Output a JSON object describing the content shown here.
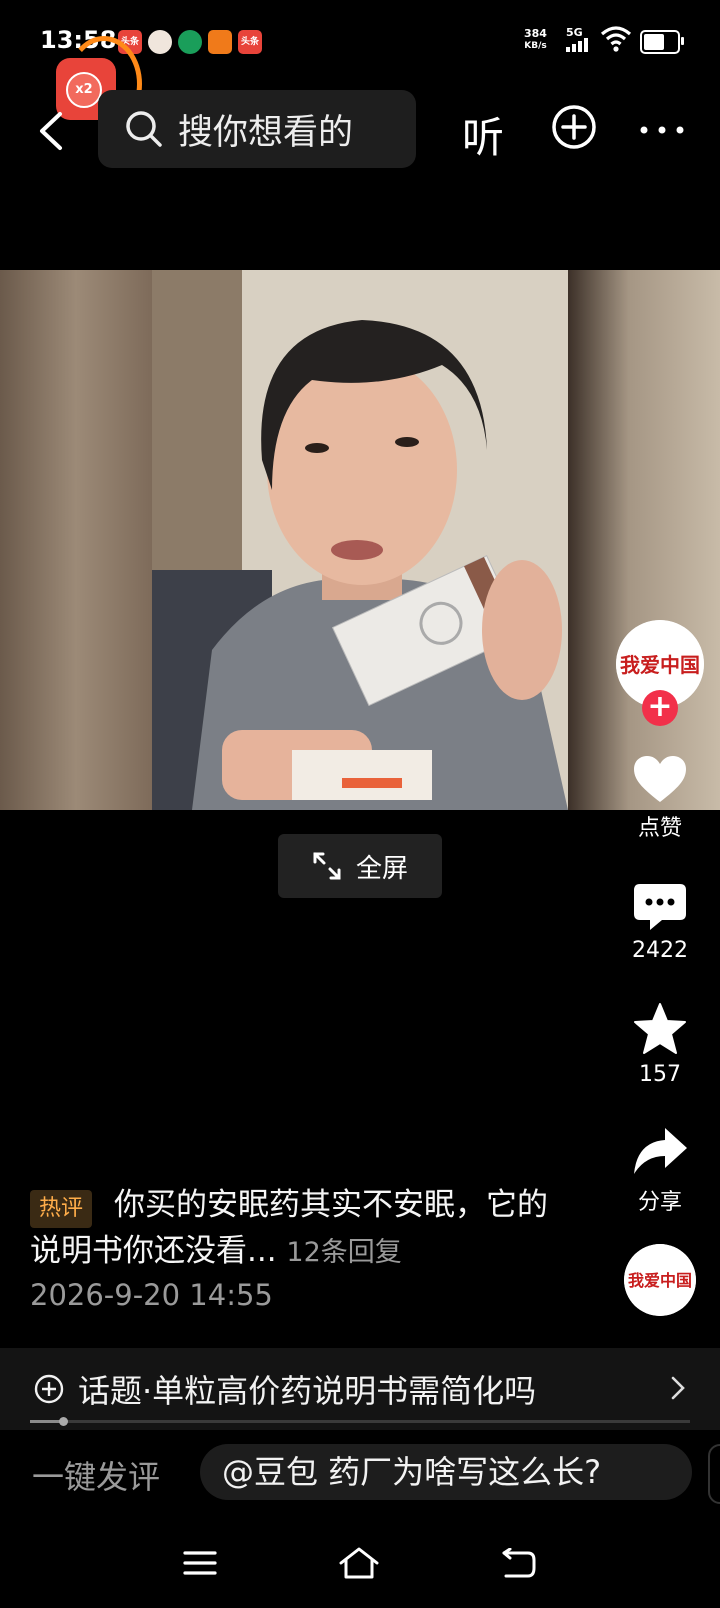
{
  "status_bar": {
    "time": "13:58",
    "net_speed_value": "384",
    "net_speed_unit": "KB/s",
    "signal_type": "5G",
    "app_icons": [
      {
        "name": "toutiao-icon",
        "label": "头条",
        "color": "#e8443a"
      },
      {
        "name": "avatar-app-icon",
        "label": "",
        "color": "#f0e6dc"
      },
      {
        "name": "green-app-icon",
        "label": "",
        "color": "#1a9e5a"
      },
      {
        "name": "orange-app-icon",
        "label": "",
        "color": "#f07a1a"
      },
      {
        "name": "toutiao-lite-icon",
        "label": "头条",
        "color": "#e8443a"
      }
    ]
  },
  "red_packet": {
    "multiplier": "x2"
  },
  "header": {
    "search_placeholder": "搜你想看的",
    "listen_label": "听"
  },
  "fullscreen": {
    "label": "全屏"
  },
  "rail": {
    "avatar_top_text": "我爱中国",
    "like_label": "点赞",
    "comments_count": "2422",
    "favorites_count": "157",
    "share_label": "分享",
    "avatar_bottom_text": "我爱中国"
  },
  "comment": {
    "tag": "热评",
    "text": "你买的安眠药其实不安眠，它的说明书你还没看...",
    "replies": "12条回复",
    "date": "2026-9-20 14:55"
  },
  "topic": {
    "text": "话题·单粒高价药说明书需简化吗"
  },
  "progress": {
    "fraction": 0.05
  },
  "quick_comment": {
    "label": "一键发评",
    "suggestion": "@豆包 药厂为啥写这么长?"
  },
  "colors": {
    "background": "#000000",
    "accent_red": "#f2304a",
    "hot_tag_orange": "#ffad4a"
  }
}
